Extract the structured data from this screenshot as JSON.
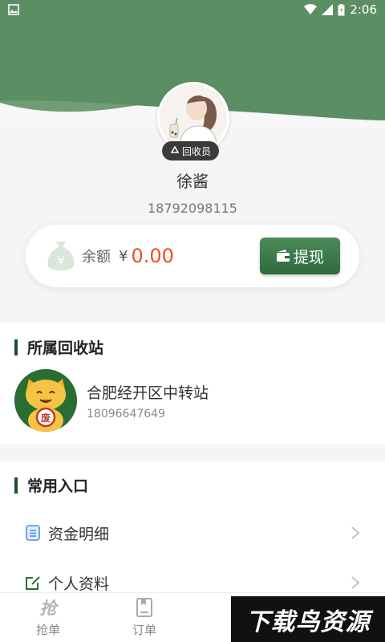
{
  "status_bar": {
    "time": "2:06"
  },
  "colors": {
    "brand_green": "#2f6b3d",
    "header_green": "#5b8f63",
    "accent_red": "#ef4f1f"
  },
  "profile": {
    "role_badge": "回收员",
    "name": "徐酱",
    "phone": "18792098115"
  },
  "balance": {
    "label": "余额",
    "currency": "¥",
    "value": "0.00",
    "withdraw_label": "提现"
  },
  "station_section": {
    "title": "所属回收站",
    "station_name": "合肥经开区中转站",
    "station_phone": "18096647649"
  },
  "common_section": {
    "title": "常用入口",
    "items": [
      {
        "label": "资金明细",
        "icon": "document-list-icon"
      },
      {
        "label": "个人资料",
        "icon": "edit-icon"
      }
    ]
  },
  "tabbar": {
    "tabs": [
      {
        "label": "抢单",
        "icon": "grab-order-icon"
      },
      {
        "label": "订单",
        "icon": "order-icon"
      }
    ]
  },
  "watermark": {
    "text": "下载鸟资源"
  }
}
